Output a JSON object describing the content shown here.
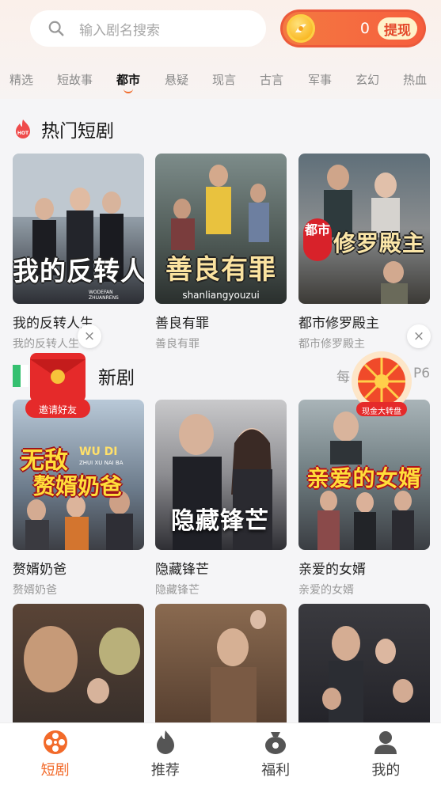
{
  "search": {
    "placeholder": "输入剧名搜索"
  },
  "wallet": {
    "amount": "0",
    "withdraw_label": "提现"
  },
  "categories": [
    {
      "label": "精选",
      "active": false
    },
    {
      "label": "短故事",
      "active": false
    },
    {
      "label": "都市",
      "active": true
    },
    {
      "label": "悬疑",
      "active": false
    },
    {
      "label": "现言",
      "active": false
    },
    {
      "label": "古言",
      "active": false
    },
    {
      "label": "军事",
      "active": false
    },
    {
      "label": "玄幻",
      "active": false
    },
    {
      "label": "热血",
      "active": false
    }
  ],
  "hot_section": {
    "title": "热门短剧",
    "badge": "HOT",
    "items": [
      {
        "name": "我的反转人生",
        "sub": "我的反转人生",
        "poster_text": "我的反转人生",
        "poster_subtext": "WODEFAN ZHUANRENS"
      },
      {
        "name": "善良有罪",
        "sub": "善良有罪",
        "poster_text": "善良有罪",
        "poster_subtext": "shanliangyouzui"
      },
      {
        "name": "都市修罗殿主",
        "sub": "都市修罗殿主",
        "poster_text": "修罗殿主",
        "poster_tag": "都市"
      }
    ]
  },
  "new_section": {
    "title_visible": "新剧",
    "more_text_left": "每",
    "more_text_right": "P6",
    "items": [
      {
        "name": "赘婿奶爸",
        "sub": "赘婿奶爸",
        "poster_text_1": "无敌",
        "poster_text_2": "赘婿奶爸",
        "poster_pinyin": "WU DI",
        "poster_pinyin_2": "ZHUI XU NAI BA"
      },
      {
        "name": "隐藏锋芒",
        "sub": "隐藏锋芒",
        "poster_text": "隐藏锋芒"
      },
      {
        "name": "亲爱的女婿",
        "sub": "亲爱的女婿",
        "poster_text": "亲爱的女婿"
      }
    ]
  },
  "floats": {
    "invite_label": "邀请好友",
    "wheel_label": "现金大转盘",
    "close_icon": "×"
  },
  "bottom_nav": [
    {
      "label": "短剧",
      "icon": "film-reel-icon",
      "active": true
    },
    {
      "label": "推荐",
      "icon": "flame-icon",
      "active": false
    },
    {
      "label": "福利",
      "icon": "money-bag-icon",
      "active": false
    },
    {
      "label": "我的",
      "icon": "user-icon",
      "active": false
    }
  ],
  "colors": {
    "accent": "#f26a2a",
    "wallet_bg": "#f65e3e",
    "withdraw_bg": "#fff2c9"
  }
}
